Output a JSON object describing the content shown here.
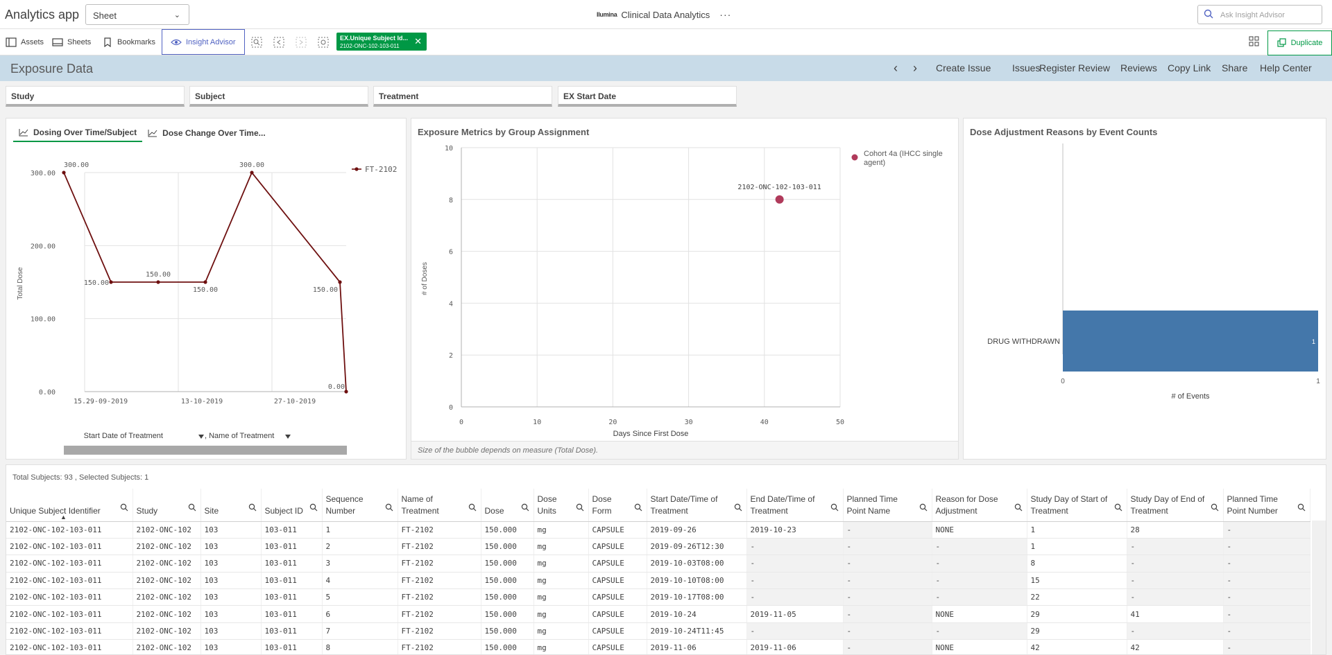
{
  "app": {
    "name": "Analytics app",
    "sheet_select": "Sheet",
    "brand_logo": "Ilumina",
    "title": "Clinical Data Analytics",
    "more": "···",
    "ask_placeholder": "Ask Insight Advisor"
  },
  "toolbar": {
    "assets": "Assets",
    "sheets": "Sheets",
    "bookmarks": "Bookmarks",
    "insight_advisor": "Insight Advisor",
    "selection_field": "EX.Unique Subject Id...",
    "selection_value": "2102-ONC-102-103-011",
    "duplicate": "Duplicate"
  },
  "sheet": {
    "title": "Exposure Data",
    "links": [
      "Create Issue",
      "Issues",
      "Register Review",
      "Reviews",
      "Copy Link",
      "Share",
      "Help Center"
    ]
  },
  "filters": [
    "Study",
    "Subject",
    "Treatment",
    "EX Start Date"
  ],
  "line_panel": {
    "tabs": [
      "Dosing Over Time/Subject",
      "Dose Change Over Time..."
    ],
    "dim1": "Start Date of Treatment",
    "dim2": ", Name of Treatment"
  },
  "bubble_panel": {
    "title": "Exposure Metrics by Group Assignment",
    "footnote": "Size of the bubble depends on measure (Total Dose)."
  },
  "bar_panel": {
    "title": "Dose Adjustment Reasons by Event Counts"
  },
  "chart_data": [
    {
      "type": "line",
      "ylabel": "Total Dose",
      "ylim": [
        0,
        300
      ],
      "y_ticks": [
        "0.00",
        "100.00",
        "200.00",
        "300.00"
      ],
      "x_ticks": [
        "15...",
        "29-09-2019",
        "13-10-2019",
        "27-10-2019"
      ],
      "series": [
        {
          "name": "FT-2102",
          "values": [
            300,
            150,
            150,
            150,
            300,
            150,
            0
          ]
        }
      ],
      "point_labels": [
        "300.00",
        "150.00",
        "150.00",
        "150.00",
        "300.00",
        "150.00",
        "0.00"
      ],
      "color": "#6e1010"
    },
    {
      "type": "scatter",
      "xlabel": "Days Since First Dose",
      "ylabel": "# of Doses",
      "xlim": [
        0,
        50
      ],
      "ylim": [
        0,
        10
      ],
      "x_ticks": [
        "0",
        "10",
        "20",
        "30",
        "40",
        "50"
      ],
      "y_ticks": [
        "0",
        "2",
        "4",
        "6",
        "8",
        "10"
      ],
      "points": [
        {
          "x": 42,
          "y": 8,
          "label": "2102-ONC-102-103-011"
        }
      ],
      "legend": "Cohort 4a (IHCC single agent)",
      "color": "#b03a5b"
    },
    {
      "type": "bar",
      "orientation": "horizontal",
      "categories": [
        "DRUG WITHDRAWN"
      ],
      "values": [
        1
      ],
      "xlabel": "# of Events",
      "xlim": [
        0,
        1
      ],
      "x_ticks": [
        "0",
        "1"
      ],
      "color": "#4477aa"
    }
  ],
  "table": {
    "summary": "Total Subjects: 93 , Selected Subjects: 1",
    "columns": [
      "Unique Subject Identifier",
      "Study",
      "Site",
      "Subject ID",
      "Sequence Number",
      "Name of Treatment",
      "Dose",
      "Dose Units",
      "Dose Form",
      "Start Date/Time of Treatment",
      "End Date/Time of Treatment",
      "Planned Time Point Name",
      "Reason for Dose Adjustment",
      "Study Day of Start of Treatment",
      "Study Day of End of Treatment",
      "Planned Time Point Number"
    ],
    "rows": [
      [
        "2102-ONC-102-103-011",
        "2102-ONC-102",
        "103",
        "103-011",
        "1",
        "FT-2102",
        "150.000",
        "mg",
        "CAPSULE",
        "2019-09-26",
        "2019-10-23",
        "-",
        "NONE",
        "1",
        "28",
        "-"
      ],
      [
        "2102-ONC-102-103-011",
        "2102-ONC-102",
        "103",
        "103-011",
        "2",
        "FT-2102",
        "150.000",
        "mg",
        "CAPSULE",
        "2019-09-26T12:30",
        "-",
        "-",
        "-",
        "1",
        "-",
        "-"
      ],
      [
        "2102-ONC-102-103-011",
        "2102-ONC-102",
        "103",
        "103-011",
        "3",
        "FT-2102",
        "150.000",
        "mg",
        "CAPSULE",
        "2019-10-03T08:00",
        "-",
        "-",
        "-",
        "8",
        "-",
        "-"
      ],
      [
        "2102-ONC-102-103-011",
        "2102-ONC-102",
        "103",
        "103-011",
        "4",
        "FT-2102",
        "150.000",
        "mg",
        "CAPSULE",
        "2019-10-10T08:00",
        "-",
        "-",
        "-",
        "15",
        "-",
        "-"
      ],
      [
        "2102-ONC-102-103-011",
        "2102-ONC-102",
        "103",
        "103-011",
        "5",
        "FT-2102",
        "150.000",
        "mg",
        "CAPSULE",
        "2019-10-17T08:00",
        "-",
        "-",
        "-",
        "22",
        "-",
        "-"
      ],
      [
        "2102-ONC-102-103-011",
        "2102-ONC-102",
        "103",
        "103-011",
        "6",
        "FT-2102",
        "150.000",
        "mg",
        "CAPSULE",
        "2019-10-24",
        "2019-11-05",
        "-",
        "NONE",
        "29",
        "41",
        "-"
      ],
      [
        "2102-ONC-102-103-011",
        "2102-ONC-102",
        "103",
        "103-011",
        "7",
        "FT-2102",
        "150.000",
        "mg",
        "CAPSULE",
        "2019-10-24T11:45",
        "-",
        "-",
        "-",
        "29",
        "-",
        "-"
      ],
      [
        "2102-ONC-102-103-011",
        "2102-ONC-102",
        "103",
        "103-011",
        "8",
        "FT-2102",
        "150.000",
        "mg",
        "CAPSULE",
        "2019-11-06",
        "2019-11-06",
        "-",
        "NONE",
        "42",
        "42",
        "-"
      ]
    ]
  }
}
